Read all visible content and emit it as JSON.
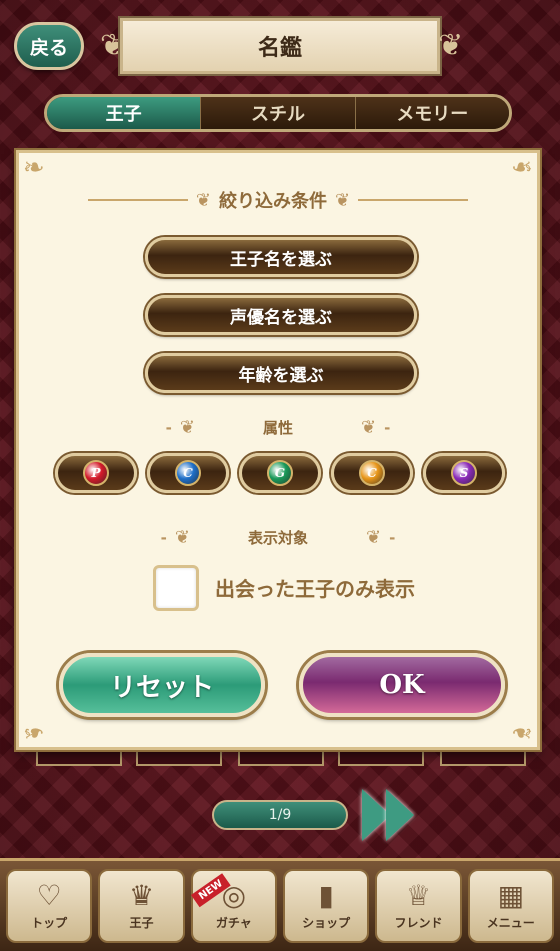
{
  "header": {
    "back_label": "戻る",
    "title": "名鑑"
  },
  "tabs": [
    {
      "label": "王子",
      "active": true
    },
    {
      "label": "スチル",
      "active": false
    },
    {
      "label": "メモリー",
      "active": false
    }
  ],
  "filter": {
    "heading": "絞り込み条件",
    "buttons": [
      "王子名を選ぶ",
      "声優名を選ぶ",
      "年齢を選ぶ"
    ],
    "attribute_heading": "属性",
    "attributes": [
      {
        "letter": "P",
        "color": "#d41a2a"
      },
      {
        "letter": "C",
        "color": "#1f6fc8"
      },
      {
        "letter": "G",
        "color": "#1a9a5a"
      },
      {
        "letter": "C",
        "color": "#e8961a"
      },
      {
        "letter": "S",
        "color": "#8a2ab8"
      }
    ],
    "display_heading": "表示対象",
    "checkbox_label": "出会った王子のみ表示",
    "checkbox_checked": false,
    "reset_label": "リセット",
    "ok_label": "OK"
  },
  "pagination": {
    "text": "1/9"
  },
  "bottom_nav": [
    {
      "label": "トップ",
      "icon": "heart-icon"
    },
    {
      "label": "王子",
      "icon": "crown-icon"
    },
    {
      "label": "ガチャ",
      "icon": "ring-icon",
      "badge": "NEW"
    },
    {
      "label": "ショップ",
      "icon": "bottle-icon"
    },
    {
      "label": "フレンド",
      "icon": "tiara-icon"
    },
    {
      "label": "メニュー",
      "icon": "grid-icon"
    }
  ]
}
